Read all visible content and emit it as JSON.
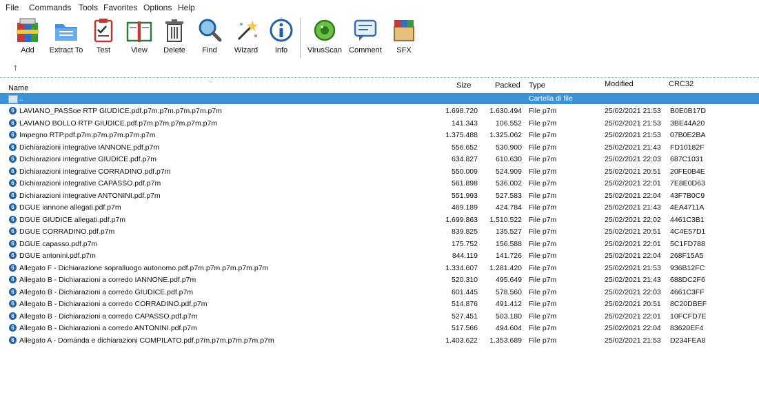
{
  "menu": [
    "File",
    "Commands",
    "Tools",
    "Favorites",
    "Options",
    "Help"
  ],
  "toolbar": [
    {
      "label": "Add",
      "icon": "add-archive-icon"
    },
    {
      "label": "Extract To",
      "icon": "extract-folder-icon"
    },
    {
      "label": "Test",
      "icon": "test-clipboard-icon"
    },
    {
      "label": "View",
      "icon": "view-book-icon"
    },
    {
      "label": "Delete",
      "icon": "delete-trash-icon"
    },
    {
      "label": "Find",
      "icon": "find-magnifier-icon"
    },
    {
      "label": "Wizard",
      "icon": "wizard-wand-icon"
    },
    {
      "label": "Info",
      "icon": "info-icon"
    },
    {
      "label": "VirusScan",
      "icon": "virus-scan-icon"
    },
    {
      "label": "Comment",
      "icon": "comment-icon"
    },
    {
      "label": "SFX",
      "icon": "sfx-box-icon"
    }
  ],
  "nav": {
    "up": "↑"
  },
  "columns": {
    "name": "Name",
    "size": "Size",
    "packed": "Packed",
    "type": "Type",
    "modified": "Modified",
    "crc": "CRC32"
  },
  "parent_row": {
    "name": "..",
    "type": "Cartella di file"
  },
  "files": [
    {
      "name": "LAVIANO_PASSoe RTP GIUDICE.pdf.p7m.p7m.p7m.p7m.p7m",
      "size": "1.698.720",
      "packed": "1.630.494",
      "type": "File p7m",
      "modified": "25/02/2021 21:53",
      "crc": "B0E0B17D"
    },
    {
      "name": "LAVIANO BOLLO RTP GIUDICE.pdf.p7m.p7m.p7m.p7m.p7m",
      "size": "141.343",
      "packed": "106.552",
      "type": "File p7m",
      "modified": "25/02/2021 21:53",
      "crc": "3BE44A20"
    },
    {
      "name": "Impegno RTP.pdf.p7m.p7m.p7m.p7m.p7m",
      "size": "1.375.488",
      "packed": "1.325.062",
      "type": "File p7m",
      "modified": "25/02/2021 21:53",
      "crc": "07B0E2BA"
    },
    {
      "name": "Dichiarazioni integrative IANNONE.pdf.p7m",
      "size": "556.652",
      "packed": "530.900",
      "type": "File p7m",
      "modified": "25/02/2021 21:43",
      "crc": "FD10182F"
    },
    {
      "name": "Dichiarazioni integrative GIUDICE.pdf.p7m",
      "size": "634.827",
      "packed": "610.630",
      "type": "File p7m",
      "modified": "25/02/2021 22:03",
      "crc": "687C1031"
    },
    {
      "name": "Dichiarazioni integrative CORRADINO.pdf.p7m",
      "size": "550.009",
      "packed": "524.909",
      "type": "File p7m",
      "modified": "25/02/2021 20:51",
      "crc": "20FE0B4E"
    },
    {
      "name": "Dichiarazioni integrative CAPASSO.pdf.p7m",
      "size": "561.898",
      "packed": "536.002",
      "type": "File p7m",
      "modified": "25/02/2021 22:01",
      "crc": "7E8E0D63"
    },
    {
      "name": "Dichiarazioni integrative ANTONINI.pdf.p7m",
      "size": "551.993",
      "packed": "527.583",
      "type": "File p7m",
      "modified": "25/02/2021 22:04",
      "crc": "43F7B0C9"
    },
    {
      "name": "DGUE iannone allegati.pdf.p7m",
      "size": "469.189",
      "packed": "424.784",
      "type": "File p7m",
      "modified": "25/02/2021 21:43",
      "crc": "4EA4711A"
    },
    {
      "name": "DGUE GIUDICE allegati.pdf.p7m",
      "size": "1.699.863",
      "packed": "1.510.522",
      "type": "File p7m",
      "modified": "25/02/2021 22:02",
      "crc": "4461C3B1"
    },
    {
      "name": "DGUE CORRADINO.pdf.p7m",
      "size": "839.825",
      "packed": "135.527",
      "type": "File p7m",
      "modified": "25/02/2021 20:51",
      "crc": "4C4E57D1"
    },
    {
      "name": "DGUE capasso.pdf.p7m",
      "size": "175.752",
      "packed": "156.588",
      "type": "File p7m",
      "modified": "25/02/2021 22:01",
      "crc": "5C1FD788"
    },
    {
      "name": "DGUE antonini.pdf.p7m",
      "size": "844.119",
      "packed": "141.726",
      "type": "File p7m",
      "modified": "25/02/2021 22:04",
      "crc": "268F15A5"
    },
    {
      "name": "Allegato F - Dichiarazione sopralluogo autonomo.pdf.p7m.p7m.p7m.p7m.p7m",
      "size": "1.334.607",
      "packed": "1.281.420",
      "type": "File p7m",
      "modified": "25/02/2021 21:53",
      "crc": "936B12FC"
    },
    {
      "name": "Allegato B - Dichiarazioni a corredo IANNONE.pdf.p7m",
      "size": "520.310",
      "packed": "495.649",
      "type": "File p7m",
      "modified": "25/02/2021 21:43",
      "crc": "688DC2F6"
    },
    {
      "name": "Allegato B - Dichiarazioni a corredo GIUDICE.pdf.p7m",
      "size": "601.445",
      "packed": "578.560",
      "type": "File p7m",
      "modified": "25/02/2021 22:03",
      "crc": "4661C3FF"
    },
    {
      "name": "Allegato B - Dichiarazioni a corredo CORRADINO.pdf.p7m",
      "size": "514.876",
      "packed": "491.412",
      "type": "File p7m",
      "modified": "25/02/2021 20:51",
      "crc": "8C20DBEF"
    },
    {
      "name": "Allegato B - Dichiarazioni a corredo CAPASSO.pdf.p7m",
      "size": "527.451",
      "packed": "503.180",
      "type": "File p7m",
      "modified": "25/02/2021 22:01",
      "crc": "10FCFD7E"
    },
    {
      "name": "Allegato B - Dichiarazioni a corredo ANTONINI.pdf.p7m",
      "size": "517.566",
      "packed": "494.604",
      "type": "File p7m",
      "modified": "25/02/2021 22:04",
      "crc": "83620EF4"
    },
    {
      "name": "Allegato A - Domanda e dichiarazioni COMPILATO.pdf.p7m.p7m.p7m.p7m.p7m",
      "size": "1.403.622",
      "packed": "1.353.689",
      "type": "File p7m",
      "modified": "25/02/2021 21:53",
      "crc": "D234FEA8"
    }
  ],
  "colors": {
    "selection": "#3c92d6",
    "file_icon": "#1f5fa8"
  }
}
